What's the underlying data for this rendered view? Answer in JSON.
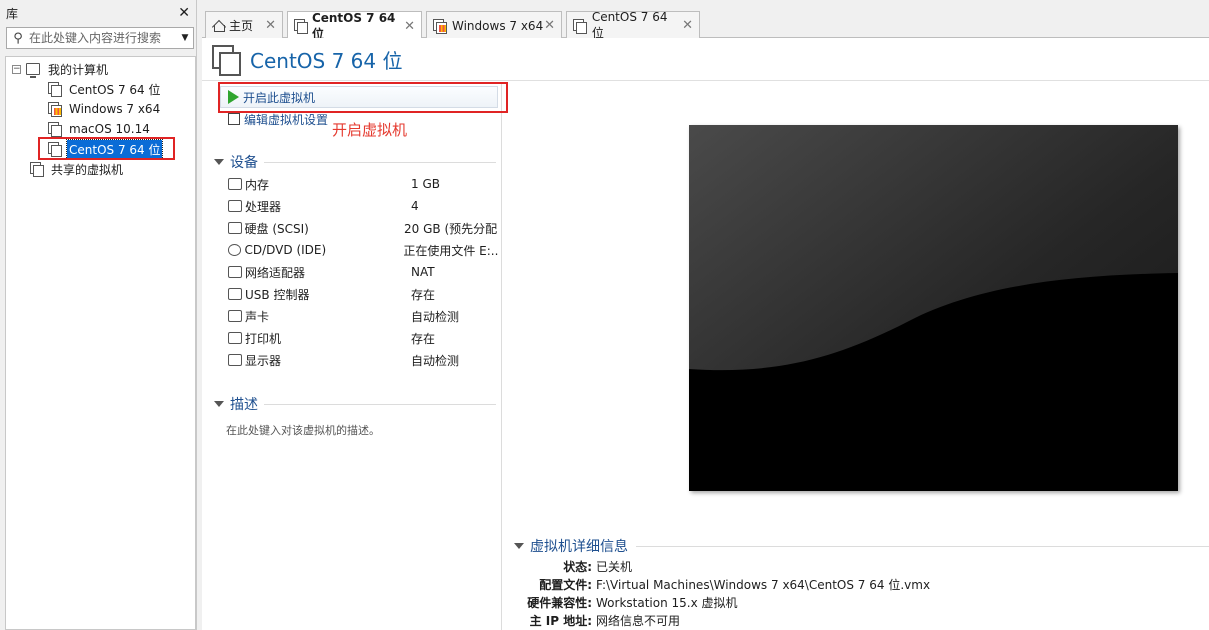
{
  "library": {
    "title": "库",
    "search_placeholder": "在此处键入内容进行搜索",
    "tree": {
      "my_computer": "我的计算机",
      "vms": [
        "CentOS 7 64 位",
        "Windows 7 x64",
        "macOS 10.14",
        "CentOS 7 64 位"
      ],
      "shared": "共享的虚拟机"
    }
  },
  "tabs": [
    {
      "label": "主页",
      "icon": "home-icon"
    },
    {
      "label": "CentOS 7 64 位",
      "icon": "vm-icon",
      "active": true
    },
    {
      "label": "Windows 7 x64",
      "icon": "windows-vm-icon"
    },
    {
      "label": "CentOS 7 64 位",
      "icon": "vm-icon"
    }
  ],
  "vm_title": "CentOS 7 64 位",
  "actions": {
    "start": "开启此虚拟机",
    "edit": "编辑虚拟机设置"
  },
  "annotation": "开启虚拟机",
  "sections": {
    "devices": "设备",
    "description": "描述",
    "details": "虚拟机详细信息"
  },
  "devices": [
    {
      "name": "内存",
      "value": "1 GB",
      "icon": "memory-icon"
    },
    {
      "name": "处理器",
      "value": "4",
      "icon": "cpu-icon"
    },
    {
      "name": "硬盘 (SCSI)",
      "value": "20 GB (预先分配)",
      "icon": "hard-disk-icon"
    },
    {
      "name": "CD/DVD (IDE)",
      "value": "正在使用文件 E:...",
      "icon": "cd-dvd-icon"
    },
    {
      "name": "网络适配器",
      "value": "NAT",
      "icon": "network-icon"
    },
    {
      "name": "USB 控制器",
      "value": "存在",
      "icon": "usb-icon"
    },
    {
      "name": "声卡",
      "value": "自动检测",
      "icon": "sound-icon"
    },
    {
      "name": "打印机",
      "value": "存在",
      "icon": "printer-icon"
    },
    {
      "name": "显示器",
      "value": "自动检测",
      "icon": "display-icon"
    }
  ],
  "description_placeholder": "在此处键入对该虚拟机的描述。",
  "details": [
    {
      "key": "状态:",
      "value": "已关机"
    },
    {
      "key": "配置文件:",
      "value": "F:\\Virtual Machines\\Windows 7 x64\\CentOS 7 64 位.vmx"
    },
    {
      "key": "硬件兼容性:",
      "value": "Workstation 15.x 虚拟机"
    },
    {
      "key": "主 IP 地址:",
      "value": "网络信息不可用"
    }
  ],
  "colors": {
    "accent": "#1764a9",
    "selection": "#0a6cd6",
    "annotation_red": "#e02424"
  }
}
